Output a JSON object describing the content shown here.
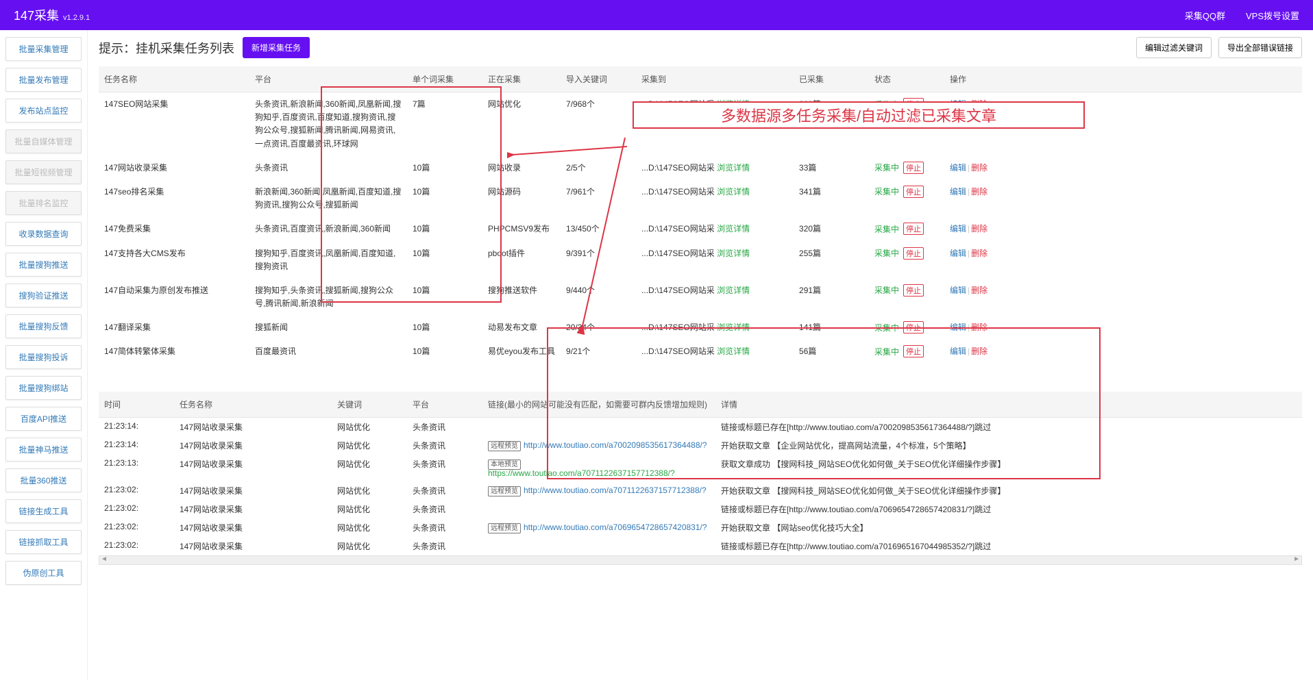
{
  "header": {
    "title": "147采集",
    "version": "v1.2.9.1",
    "link_qq": "采集QQ群",
    "link_vps": "VPS拨号设置"
  },
  "sidebar": {
    "items": [
      {
        "label": "批量采集管理",
        "disabled": false
      },
      {
        "label": "批量发布管理",
        "disabled": false
      },
      {
        "label": "发布站点监控",
        "disabled": false
      },
      {
        "label": "批量自媒体管理",
        "disabled": true
      },
      {
        "label": "批量短视频管理",
        "disabled": true
      },
      {
        "label": "批量排名监控",
        "disabled": true
      },
      {
        "label": "收录数据查询",
        "disabled": false
      },
      {
        "label": "批量搜狗推送",
        "disabled": false
      },
      {
        "label": "搜狗验证推送",
        "disabled": false
      },
      {
        "label": "批量搜狗反馈",
        "disabled": false
      },
      {
        "label": "批量搜狗投诉",
        "disabled": false
      },
      {
        "label": "批量搜狗绑站",
        "disabled": false
      },
      {
        "label": "百度API推送",
        "disabled": false
      },
      {
        "label": "批量神马推送",
        "disabled": false
      },
      {
        "label": "批量360推送",
        "disabled": false
      },
      {
        "label": "链接生成工具",
        "disabled": false
      },
      {
        "label": "链接抓取工具",
        "disabled": false
      },
      {
        "label": "伪原创工具",
        "disabled": false
      }
    ]
  },
  "page": {
    "title": "提示：挂机采集任务列表",
    "add_btn": "新增采集任务",
    "filter_btn": "编辑过滤关键词",
    "export_btn": "导出全部错误链接"
  },
  "table_main": {
    "headers": {
      "name": "任务名称",
      "platform": "平台",
      "single": "单个词采集",
      "collecting": "正在采集",
      "import_kw": "导入关键词",
      "collect_to": "采集到",
      "collected": "已采集",
      "status": "状态",
      "op": "操作"
    },
    "status_running": "采集中",
    "status_stop": "停止",
    "op_edit": "编辑",
    "op_del": "删除",
    "detail_link": "浏览详情",
    "rows": [
      {
        "name": "147SEO网站采集",
        "platform": "头条资讯,新浪新闻,360新闻,凤凰新闻,搜狗知乎,百度资讯,百度知道,搜狗资讯,搜狗公众号,搜狐新闻,腾讯新闻,网易资讯,一点资讯,百度最资讯,环球网",
        "single": "7篇",
        "collecting": "网站优化",
        "import": "7/968个",
        "to": "...D:\\147SEO网站采",
        "collected": "260篇"
      },
      {
        "name": "147网站收录采集",
        "platform": "头条资讯",
        "single": "10篇",
        "collecting": "网站收录",
        "import": "2/5个",
        "to": "...D:\\147SEO网站采",
        "collected": "33篇"
      },
      {
        "name": "147seo排名采集",
        "platform": "新浪新闻,360新闻,凤凰新闻,百度知道,搜狗资讯,搜狗公众号,搜狐新闻",
        "single": "10篇",
        "collecting": "网站源码",
        "import": "7/961个",
        "to": "...D:\\147SEO网站采",
        "collected": "341篇"
      },
      {
        "name": "147免费采集",
        "platform": "头条资讯,百度资讯,新浪新闻,360新闻",
        "single": "10篇",
        "collecting": "PHPCMSV9发布",
        "import": "13/450个",
        "to": "...D:\\147SEO网站采",
        "collected": "320篇"
      },
      {
        "name": "147支持各大CMS发布",
        "platform": "搜狗知乎,百度资讯,凤凰新闻,百度知道,搜狗资讯",
        "single": "10篇",
        "collecting": "pboot插件",
        "import": "9/391个",
        "to": "...D:\\147SEO网站采",
        "collected": "255篇"
      },
      {
        "name": "147自动采集为原创发布推送",
        "platform": "搜狗知乎,头条资讯,搜狐新闻,搜狗公众号,腾讯新闻,新浪新闻",
        "single": "10篇",
        "collecting": "搜狗推送软件",
        "import": "9/440个",
        "to": "...D:\\147SEO网站采",
        "collected": "291篇"
      },
      {
        "name": "147翻译采集",
        "platform": "搜狐新闻",
        "single": "10篇",
        "collecting": "动易发布文章",
        "import": "20/34个",
        "to": "...D:\\147SEO网站采",
        "collected": "141篇"
      },
      {
        "name": "147简体转繁体采集",
        "platform": "百度最资讯",
        "single": "10篇",
        "collecting": "易优eyou发布工具",
        "import": "9/21个",
        "to": "...D:\\147SEO网站采",
        "collected": "56篇"
      }
    ]
  },
  "annotation": {
    "text": "多数据源多任务采集/自动过滤已采集文章"
  },
  "table_log": {
    "headers": {
      "time": "时间",
      "name": "任务名称",
      "keyword": "关键词",
      "platform": "平台",
      "link": "链接(最小的网站可能没有匹配，如需要可群内反馈增加规则)",
      "detail": "详情"
    },
    "tag_remote": "远程预览",
    "tag_local": "本地预览",
    "rows": [
      {
        "time": "21:23:14:",
        "name": "147网站收录采集",
        "keyword": "网站优化",
        "platform": "头条资讯",
        "link": "",
        "detail": "链接或标题已存在[http://www.toutiao.com/a7002098535617364488/?]跳过"
      },
      {
        "time": "21:23:14:",
        "name": "147网站收录采集",
        "keyword": "网站优化",
        "platform": "头条资讯",
        "tag": "remote",
        "link": "http://www.toutiao.com/a7002098535617364488/?",
        "detail": "开始获取文章 【企业网站优化，提高网站流量，4个标准，5个策略】"
      },
      {
        "time": "21:23:13:",
        "name": "147网站收录采集",
        "keyword": "网站优化",
        "platform": "头条资讯",
        "tag": "local",
        "link": "https://www.toutiao.com/a7071122637157712388/?",
        "detail": "获取文章成功 【搜网科技_网站SEO优化如何做_关于SEO优化详细操作步骤】"
      },
      {
        "time": "21:23:02:",
        "name": "147网站收录采集",
        "keyword": "网站优化",
        "platform": "头条资讯",
        "tag": "remote",
        "link": "http://www.toutiao.com/a7071122637157712388/?",
        "detail": "开始获取文章 【搜网科技_网站SEO优化如何做_关于SEO优化详细操作步骤】"
      },
      {
        "time": "21:23:02:",
        "name": "147网站收录采集",
        "keyword": "网站优化",
        "platform": "头条资讯",
        "link": "",
        "detail": "链接或标题已存在[http://www.toutiao.com/a7069654728657420831/?]跳过"
      },
      {
        "time": "21:23:02:",
        "name": "147网站收录采集",
        "keyword": "网站优化",
        "platform": "头条资讯",
        "tag": "remote",
        "link": "http://www.toutiao.com/a7069654728657420831/?",
        "detail": "开始获取文章 【网站seo优化技巧大全】"
      },
      {
        "time": "21:23:02:",
        "name": "147网站收录采集",
        "keyword": "网站优化",
        "platform": "头条资讯",
        "link": "",
        "detail": "链接或标题已存在[http://www.toutiao.com/a7016965167044985352/?]跳过"
      }
    ]
  }
}
